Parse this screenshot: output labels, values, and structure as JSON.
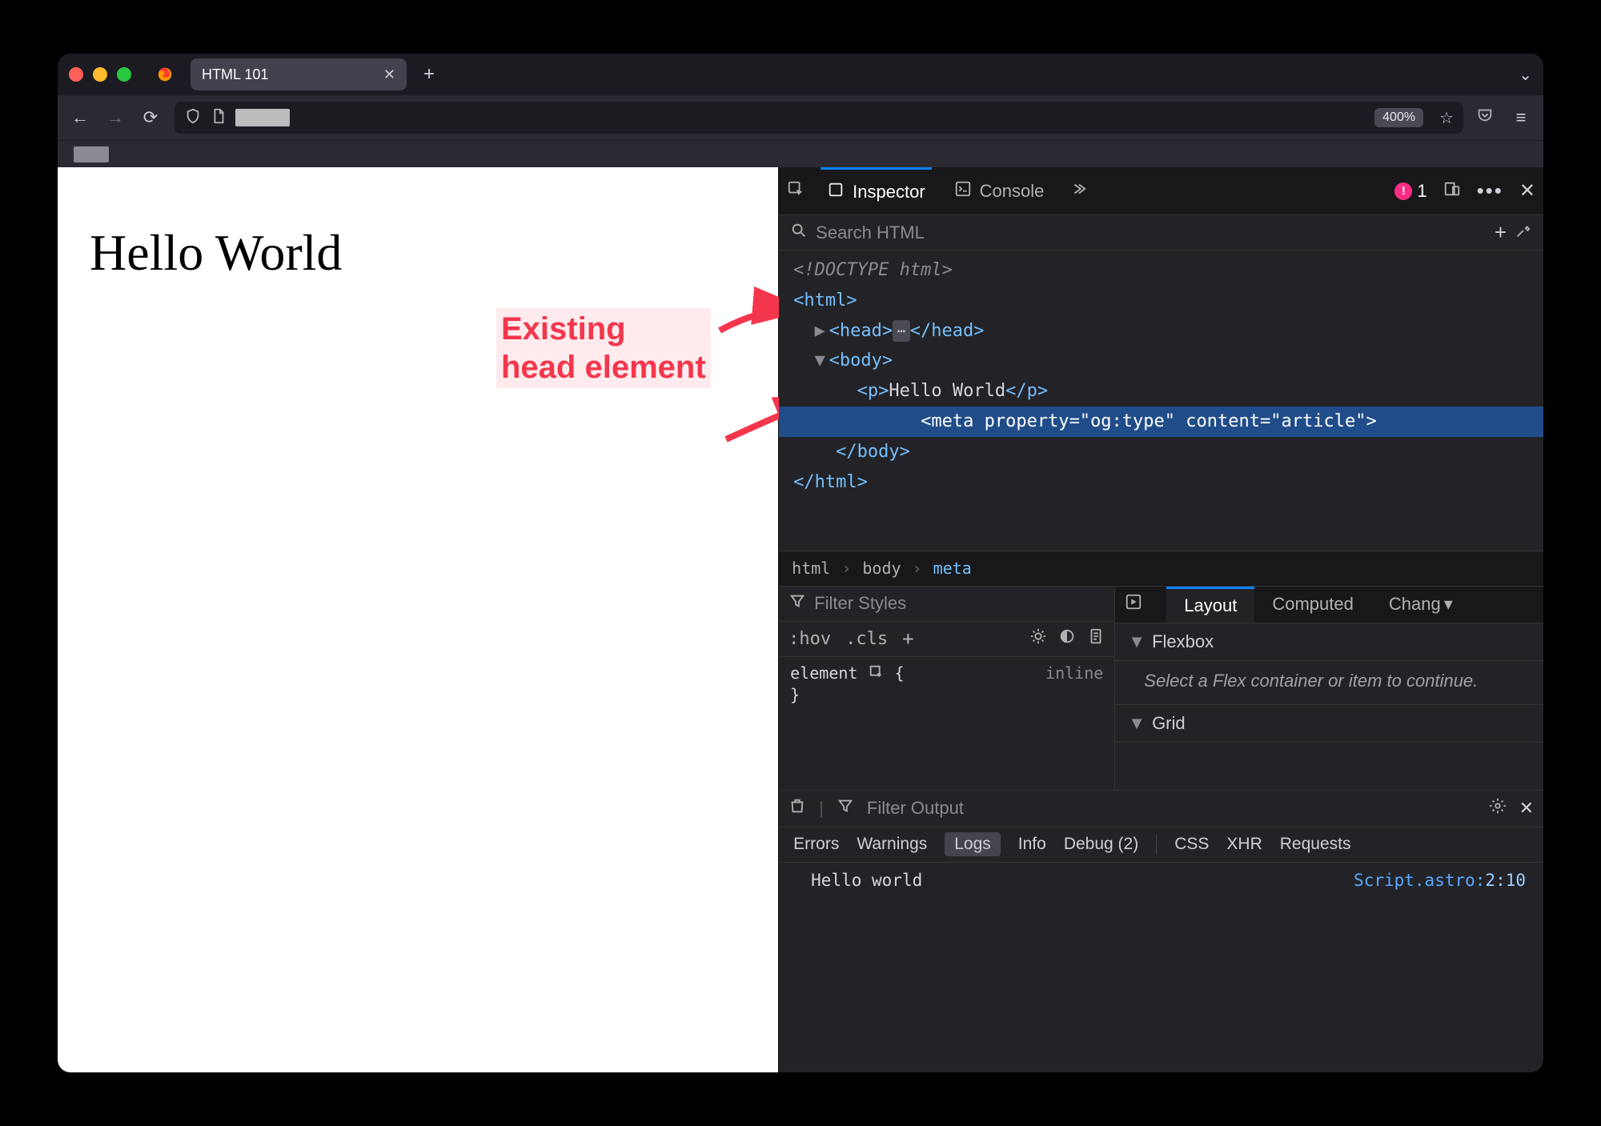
{
  "titlebar": {
    "tab_title": "HTML 101"
  },
  "navbar": {
    "zoom": "400%"
  },
  "page": {
    "heading": "Hello World"
  },
  "annotations": {
    "existing_head_l1": "Existing",
    "existing_head_l2": "head element"
  },
  "devtools": {
    "tabs": {
      "inspector": "Inspector",
      "console": "Console"
    },
    "errors": "1",
    "search_placeholder": "Search HTML",
    "dom": {
      "doctype": "<!DOCTYPE html>",
      "html_open": "html",
      "head": "head",
      "body": "body",
      "p_text": "Hello World",
      "meta_prop": "property",
      "meta_prop_v": "og:type",
      "meta_cont": "content",
      "meta_cont_v": "article"
    },
    "breadcrumbs": {
      "a": "html",
      "b": "body",
      "c": "meta"
    },
    "styles": {
      "filter": "Filter Styles",
      "hov": ":hov",
      "cls": ".cls",
      "element": "element",
      "brace_open": "{",
      "brace_close": "}",
      "inline": "inline"
    },
    "layout": {
      "tab_layout": "Layout",
      "tab_computed": "Computed",
      "tab_changes": "Chang",
      "flexbox": "Flexbox",
      "flexbox_hint": "Select a Flex container or item to continue.",
      "grid": "Grid"
    },
    "console": {
      "filter": "Filter Output",
      "errors": "Errors",
      "warnings": "Warnings",
      "logs": "Logs",
      "info": "Info",
      "debug": "Debug (2)",
      "css": "CSS",
      "xhr": "XHR",
      "requests": "Requests",
      "msg": "Hello world",
      "loc_file": "Script.astro",
      "loc_line": "2:10"
    }
  }
}
